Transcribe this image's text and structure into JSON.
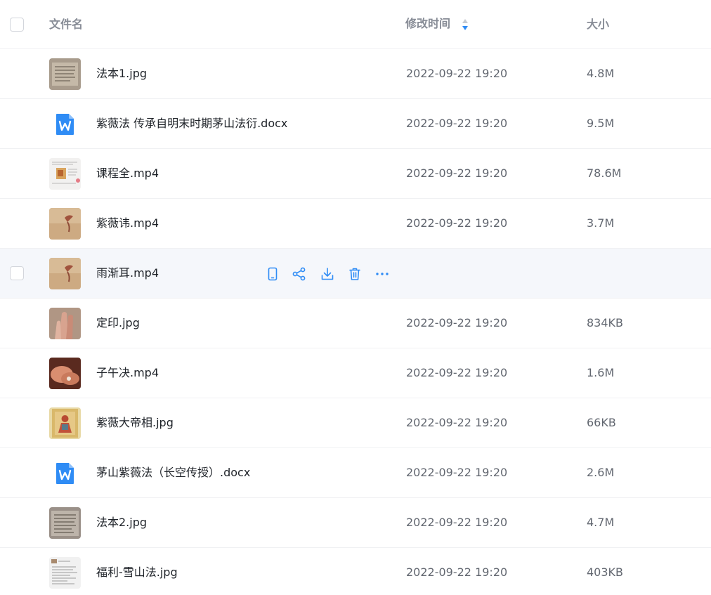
{
  "header": {
    "name_label": "文件名",
    "time_label": "修改时间",
    "size_label": "大小"
  },
  "colors": {
    "accent": "#2f8cf5",
    "header_text": "#878c96",
    "hover_row": "#f5f7fb"
  },
  "hover_actions": [
    "phone-icon",
    "share-icon",
    "download-icon",
    "trash-icon",
    "more-icon"
  ],
  "files": [
    {
      "name": "法本1.jpg",
      "time": "2022-09-22 19:20",
      "size": "4.8M",
      "icon": "image-thumbnail"
    },
    {
      "name": "紫薇法 传承自明末时期茅山法衍.docx",
      "time": "2022-09-22 19:20",
      "size": "9.5M",
      "icon": "word-doc-icon"
    },
    {
      "name": "课程全.mp4",
      "time": "2022-09-22 19:20",
      "size": "78.6M",
      "icon": "video-thumbnail"
    },
    {
      "name": "紫薇讳.mp4",
      "time": "2022-09-22 19:20",
      "size": "3.7M",
      "icon": "video-thumbnail"
    },
    {
      "name": "雨渐耳.mp4",
      "time": "",
      "size": "",
      "icon": "video-thumbnail",
      "hovered": true
    },
    {
      "name": "定印.jpg",
      "time": "2022-09-22 19:20",
      "size": "834KB",
      "icon": "image-thumbnail"
    },
    {
      "name": "子午决.mp4",
      "time": "2022-09-22 19:20",
      "size": "1.6M",
      "icon": "video-thumbnail"
    },
    {
      "name": "紫薇大帝相.jpg",
      "time": "2022-09-22 19:20",
      "size": "66KB",
      "icon": "image-thumbnail"
    },
    {
      "name": "茅山紫薇法（长空传授）.docx",
      "time": "2022-09-22 19:20",
      "size": "2.6M",
      "icon": "word-doc-icon"
    },
    {
      "name": "法本2.jpg",
      "time": "2022-09-22 19:20",
      "size": "4.7M",
      "icon": "image-thumbnail"
    },
    {
      "name": "福利-雪山法.jpg",
      "time": "2022-09-22 19:20",
      "size": "403KB",
      "icon": "image-thumbnail"
    }
  ]
}
